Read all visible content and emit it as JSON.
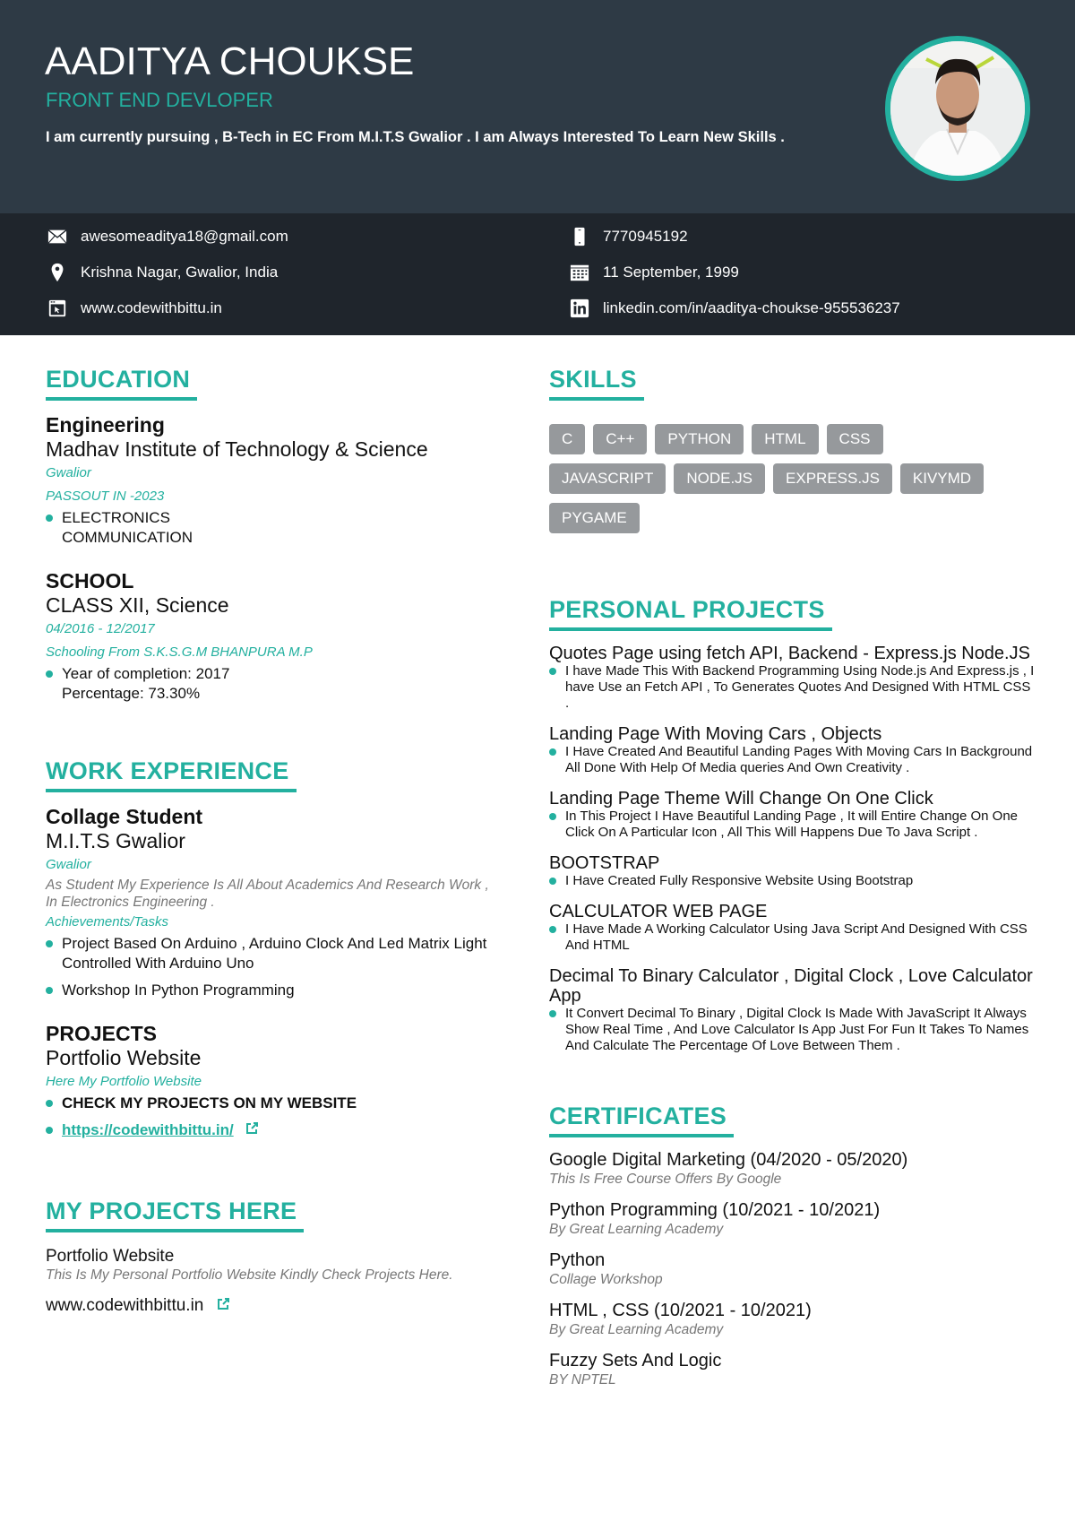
{
  "header": {
    "name": "AADITYA CHOUKSE",
    "role": "FRONT END DEVLOPER",
    "summary": "I am currently pursuing , B-Tech in EC From M.I.T.S Gwalior . I am Always Interested To Learn New Skills .",
    "photo_alt": "profile-photo"
  },
  "contact": {
    "email": "awesomeaditya18@gmail.com",
    "location": "Krishna Nagar, Gwalior, India",
    "website": "www.codewithbittu.in",
    "phone": "7770945192",
    "birthdate": "11 September, 1999",
    "linkedin": "linkedin.com/in/aaditya-choukse-955536237"
  },
  "colors": {
    "accent": "#23b09f",
    "header_bg": "#2e3a45",
    "contact_bg": "#1f252c",
    "skill_bg": "#96999c"
  },
  "education": {
    "title": "EDUCATION",
    "entries": [
      {
        "degree": "Engineering",
        "institution": "Madhav Institute of Technology & Science",
        "location": "Gwalior",
        "date": "PASSOUT IN -2023",
        "bullets": [
          "ELECTRONICS\nCOMMUNICATION"
        ]
      },
      {
        "degree": "SCHOOL",
        "institution": "CLASS XII, Science",
        "date": "04/2016 - 12/2017",
        "note": "Schooling From S.K.S.G.M BHANPURA M.P",
        "bullets": [
          "Year of completion: 2017\nPercentage: 73.30%"
        ]
      }
    ]
  },
  "work": {
    "title": "WORK EXPERIENCE",
    "entries": [
      {
        "role": "Collage Student",
        "org": "M.I.T.S Gwalior",
        "location": "Gwalior",
        "description": "As Student My Experience Is All About Academics And Research Work , In Electronics Engineering .",
        "tasks_label": "Achievements/Tasks",
        "tasks": [
          "Project Based On Arduino , Arduino Clock And Led Matrix Light Controlled With Arduino Uno",
          "Workshop In Python Programming"
        ]
      },
      {
        "role": "PROJECTS",
        "org": "Portfolio Website",
        "location": "Here My Portfolio Website",
        "bullets": [
          "CHECK MY PROJECTS ON MY WEBSITE"
        ],
        "link": "https://codewithbittu.in/"
      }
    ]
  },
  "my_projects": {
    "title": "MY PROJECTS HERE",
    "name": "Portfolio Website",
    "description": "This Is My Personal Portfolio Website Kindly Check Projects Here.",
    "link": "www.codewithbittu.in"
  },
  "skills": {
    "title": "SKILLS",
    "items": [
      "C",
      "C++",
      "PYTHON",
      "HTML",
      "CSS",
      "JAVASCRIPT",
      "NODE.JS",
      "EXPRESS.JS",
      "KIVYMD",
      "PYGAME"
    ]
  },
  "personal_projects": {
    "title": "PERSONAL PROJECTS",
    "items": [
      {
        "name": "Quotes Page using fetch API, Backend - Express.js Node.JS",
        "desc": "I have Made This With Backend Programming Using Node.js And Express.js , I have Use an Fetch API , To Generates Quotes And Designed With HTML CSS ."
      },
      {
        "name": "Landing Page With Moving Cars , Objects",
        "desc": "I Have Created And Beautiful Landing Pages With Moving Cars In Background All Done With Help Of Media queries And Own Creativity ."
      },
      {
        "name": "Landing Page Theme Will Change On One Click",
        "desc": "In This Project I Have Beautiful Landing Page , It will Entire Change On One Click On A Particular Icon , All This Will Happens Due To Java Script ."
      },
      {
        "name": "BOOTSTRAP",
        "desc": "I Have Created Fully Responsive Website Using Bootstrap"
      },
      {
        "name": "CALCULATOR WEB PAGE",
        "desc": "I Have Made A Working Calculator Using Java Script And Designed With CSS And HTML"
      },
      {
        "name": "Decimal To Binary Calculator , Digital Clock , Love Calculator App",
        "desc": "It Convert Decimal To Binary , Digital Clock Is Made With JavaScript It Always Show Real Time , And Love Calculator Is App Just For Fun It Takes To Names And Calculate The Percentage Of Love Between Them ."
      }
    ]
  },
  "certificates": {
    "title": "CERTIFICATES",
    "items": [
      {
        "name": "Google Digital Marketing (04/2020 - 05/2020)",
        "issuer": "This Is Free Course Offers By Google"
      },
      {
        "name": "Python Programming (10/2021 - 10/2021)",
        "issuer": "By Great Learning Academy"
      },
      {
        "name": "Python",
        "issuer": "Collage Workshop"
      },
      {
        "name": "HTML , CSS (10/2021 - 10/2021)",
        "issuer": "By Great Learning Academy"
      },
      {
        "name": "Fuzzy Sets And Logic",
        "issuer": "BY NPTEL"
      }
    ]
  }
}
